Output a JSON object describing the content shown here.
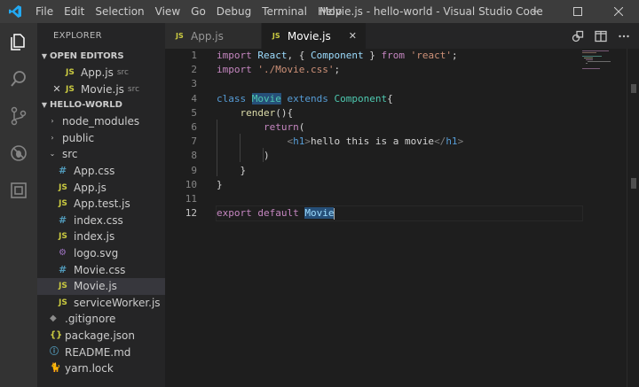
{
  "titlebar": {
    "menu": [
      "File",
      "Edit",
      "Selection",
      "View",
      "Go",
      "Debug",
      "Terminal",
      "Help"
    ],
    "window_title": "Movie.js - hello-world - Visual Studio Code"
  },
  "sidebar": {
    "title": "EXPLORER",
    "open_editors": {
      "label": "OPEN EDITORS",
      "items": [
        {
          "name": "App.js",
          "folder": "src",
          "icon": "JS"
        },
        {
          "name": "Movie.js",
          "folder": "src",
          "icon": "JS",
          "close": "✕"
        }
      ]
    },
    "project": {
      "label": "HELLO-WORLD",
      "items": [
        {
          "name": "node_modules",
          "icon": "›"
        },
        {
          "name": "public",
          "icon": "›"
        },
        {
          "name": "src",
          "icon": "⌄"
        },
        {
          "name": "App.css",
          "icon": "#"
        },
        {
          "name": "App.js",
          "icon": "JS"
        },
        {
          "name": "App.test.js",
          "icon": "JS"
        },
        {
          "name": "index.css",
          "icon": "#"
        },
        {
          "name": "index.js",
          "icon": "JS"
        },
        {
          "name": "logo.svg",
          "icon": "⚙"
        },
        {
          "name": "Movie.css",
          "icon": "#"
        },
        {
          "name": "Movie.js",
          "icon": "JS"
        },
        {
          "name": "serviceWorker.js",
          "icon": "JS"
        },
        {
          "name": ".gitignore",
          "icon": "◆"
        },
        {
          "name": "package.json",
          "icon": "{}"
        },
        {
          "name": "README.md",
          "icon": "ⓘ"
        },
        {
          "name": "yarn.lock",
          "icon": "🐈"
        }
      ]
    }
  },
  "tabs": [
    {
      "label": "App.js",
      "icon": "JS"
    },
    {
      "label": "Movie.js",
      "icon": "JS",
      "close": "✕"
    }
  ],
  "editor": {
    "line_numbers": [
      "1",
      "2",
      "3",
      "4",
      "5",
      "6",
      "7",
      "8",
      "9",
      "10",
      "11",
      "12"
    ],
    "code": {
      "l1": {
        "t1": "import",
        "t2": "React",
        "t3": ", { ",
        "t4": "Component",
        "t5": " } ",
        "t6": "from",
        "t7": "'react'",
        "t8": ";"
      },
      "l2": {
        "t1": "import",
        "t2": "'./Movie.css'",
        "t3": ";"
      },
      "l4": {
        "t1": "class",
        "t2": "Movie",
        "t3": "extends",
        "t4": "Component",
        "t5": "{"
      },
      "l5": {
        "t1": "render",
        "t2": "(){"
      },
      "l6": {
        "t1": "return",
        "t2": "("
      },
      "l7": {
        "t1": "<",
        "t2": "h1",
        "t3": ">",
        "t4": "hello this is a movie",
        "t5": "</",
        "t6": "h1",
        "t7": ">"
      },
      "l8": {
        "t1": ")"
      },
      "l9": {
        "t1": "}"
      },
      "l10": {
        "t1": "}"
      },
      "l12": {
        "t1": "export",
        "t2": "default",
        "t3": "Movie"
      }
    }
  },
  "colors": {
    "accent_logo": "#23a9f2",
    "keyword_purple": "#c586c0",
    "keyword_blue": "#569cd6",
    "string": "#ce9178",
    "class_name": "#4ec9b0",
    "js_icon": "#cbcb41"
  }
}
